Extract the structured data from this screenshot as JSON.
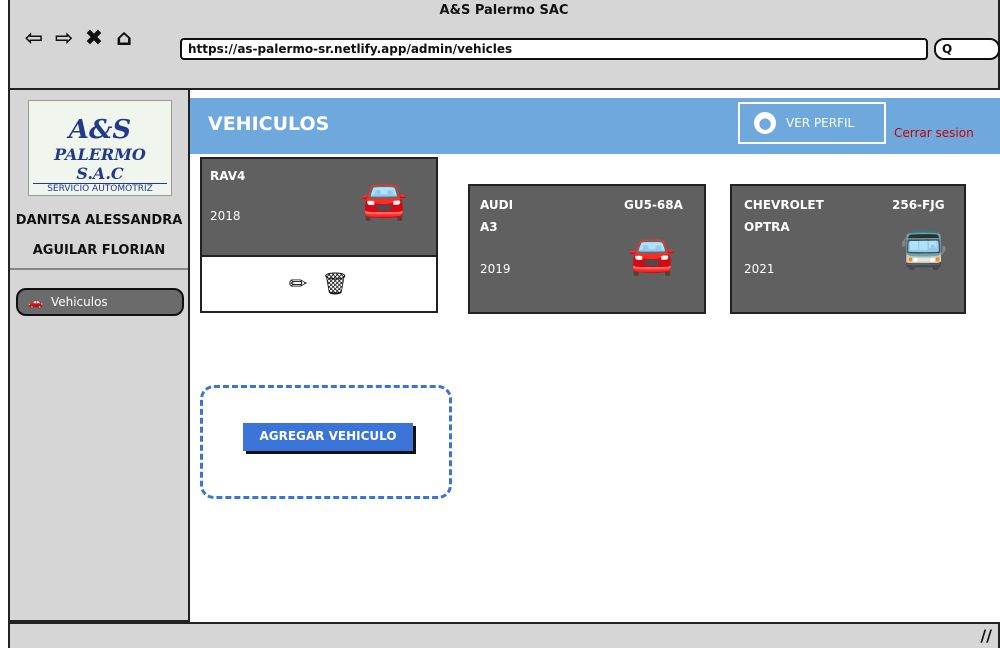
{
  "browser": {
    "window_title": "A&S Palermo SAC",
    "url": "https://as-palermo-sr.netlify.app/admin/vehicles",
    "search_value": "Q"
  },
  "sidebar": {
    "logo": {
      "mark": "A&S",
      "name": "PALERMO S.A.C",
      "tagline": "SERVICIO AUTOMOTRIZ"
    },
    "user_line1": "DANITSA ALESSANDRA",
    "user_line2": "AGUILAR FLORIAN",
    "items": [
      {
        "label": "Vehiculos",
        "icon": "car-icon"
      }
    ]
  },
  "header": {
    "title": "VEHICULOS",
    "profile_label": "VER PERFIL",
    "logout_label": "Cerrar sesion"
  },
  "vehicles": [
    {
      "brand": "RAV4",
      "model": "",
      "plate": "",
      "year": "2018",
      "icon": "car-icon"
    },
    {
      "brand": "AUDI",
      "model": "A3",
      "plate": "GU5-68A",
      "year": "2019",
      "icon": "car-icon"
    },
    {
      "brand": "CHEVROLET",
      "model": "OPTRA",
      "plate": "256-FJG",
      "year": "2021",
      "icon": "bus-icon"
    }
  ],
  "add_label": "AGREGAR VEHICULO",
  "colors": {
    "header": "#6ea8dc",
    "card": "#606060",
    "primary": "#3a74d8",
    "logout": "#cc0000"
  }
}
